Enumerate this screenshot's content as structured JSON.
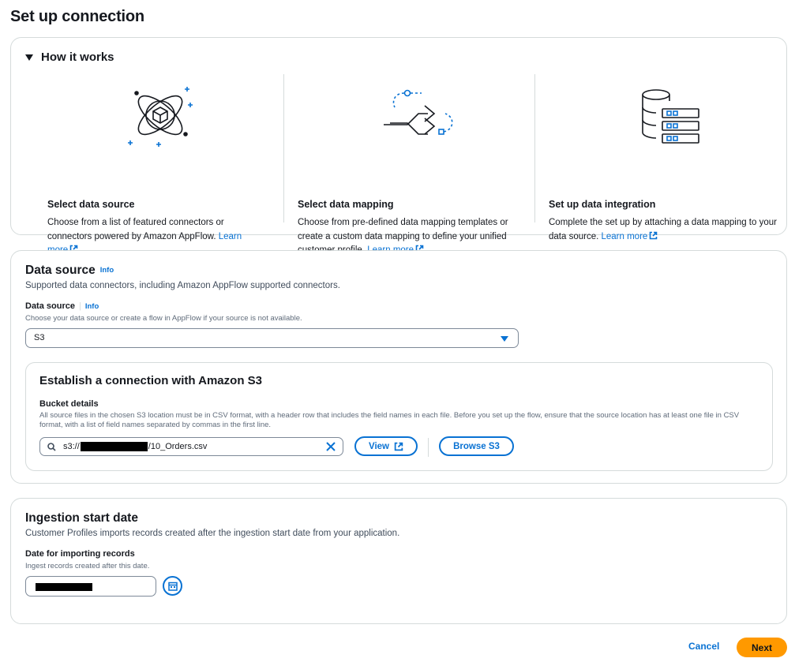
{
  "page": {
    "title": "Set up connection"
  },
  "how_it_works": {
    "header": "How it works",
    "columns": [
      {
        "title": "Select data source",
        "desc": "Choose from a list of featured connectors or connectors powered by Amazon AppFlow.",
        "link": "Learn more",
        "icon": "data-source-orbit-icon"
      },
      {
        "title": "Select data mapping",
        "desc": "Choose from pre-defined data mapping templates or create a custom data mapping to define your unified customer profile.",
        "link": "Learn more",
        "icon": "data-mapping-arrows-icon"
      },
      {
        "title": "Set up data integration",
        "desc": "Complete the set up by attaching a data mapping to your data source.",
        "link": "Learn more",
        "icon": "database-server-icon"
      }
    ]
  },
  "data_source": {
    "title": "Data source",
    "info": "Info",
    "desc": "Supported data connectors, including Amazon AppFlow supported connectors.",
    "field_label": "Data source",
    "field_info": "Info",
    "field_hint": "Choose your data source or create a flow in AppFlow if your source is not available.",
    "selected": "S3",
    "s3": {
      "title": "Establish a connection with Amazon S3",
      "bucket_label": "Bucket details",
      "bucket_desc": "All source files in the chosen S3 location must be in CSV format, with a header row that includes the field names in each file. Before you set up the flow, ensure that the source location has at least one file in CSV format, with a list of field names separated by commas in the first line.",
      "path_prefix": "s3://",
      "path_suffix": "/10_Orders.csv",
      "view_label": "View",
      "browse_label": "Browse S3"
    }
  },
  "ingestion": {
    "title": "Ingestion start date",
    "desc": "Customer Profiles imports records created after the ingestion start date from your application.",
    "field_label": "Date for importing records",
    "field_hint": "Ingest records created after this date."
  },
  "footer": {
    "cancel": "Cancel",
    "next": "Next"
  },
  "colors": {
    "accent": "#0972d3",
    "primary_button": "#ff9900",
    "border": "#d5dbdb"
  }
}
